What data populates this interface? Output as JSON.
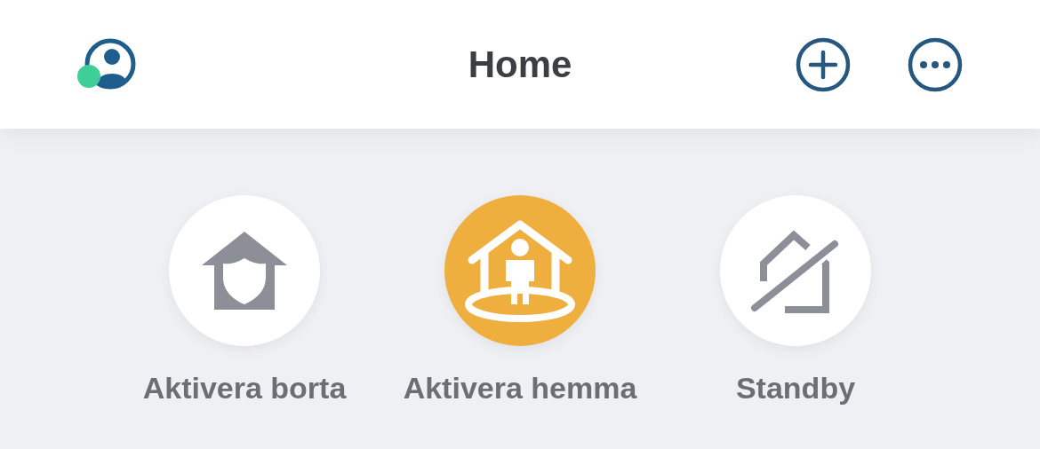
{
  "header": {
    "title": "Home"
  },
  "modes": [
    {
      "label": "Aktivera borta",
      "kind": "away",
      "selected": false
    },
    {
      "label": "Aktivera hemma",
      "kind": "home",
      "selected": true
    },
    {
      "label": "Standby",
      "kind": "standby",
      "selected": false
    }
  ]
}
